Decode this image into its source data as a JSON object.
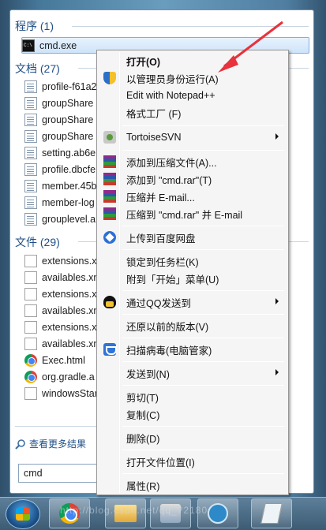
{
  "start_menu": {
    "programs_header": "程序 (1)",
    "programs": [
      {
        "label": "cmd.exe",
        "icon": "cmd-icon"
      }
    ],
    "documents_header": "文档 (27)",
    "documents": [
      {
        "label": "profile-f61a2"
      },
      {
        "label": "groupShare"
      },
      {
        "label": "groupShare"
      },
      {
        "label": "groupShare"
      },
      {
        "label": "setting.ab6e"
      },
      {
        "label": "profile.dbcfe"
      },
      {
        "label": "member.45b"
      },
      {
        "label": "member-log"
      },
      {
        "label": "grouplevel.a"
      }
    ],
    "files_header": "文件 (29)",
    "files": [
      {
        "label": "extensions.x"
      },
      {
        "label": "availables.xn"
      },
      {
        "label": "extensions.x"
      },
      {
        "label": "availables.xn"
      },
      {
        "label": "extensions.x"
      },
      {
        "label": "availables.xn"
      },
      {
        "label": "Exec.html"
      },
      {
        "label": "org.gradle.a"
      },
      {
        "label": "windowsStar"
      }
    ],
    "see_more": "查看更多结果",
    "search_value": "cmd"
  },
  "context_menu": {
    "items": [
      {
        "label": "打开(O)",
        "bold": true
      },
      {
        "label": "以管理员身份运行(A)",
        "icon": "uac-shield-icon"
      },
      {
        "label": "Edit with Notepad++"
      },
      {
        "label": "格式工厂 (F)"
      },
      {
        "label": "TortoiseSVN",
        "icon": "tortoise-svn-icon",
        "submenu": true
      },
      {
        "label": "添加到压缩文件(A)...",
        "icon": "winrar-icon"
      },
      {
        "label": "添加到 \"cmd.rar\"(T)",
        "icon": "winrar-icon"
      },
      {
        "label": "压缩并 E-mail...",
        "icon": "winrar-icon"
      },
      {
        "label": "压缩到 \"cmd.rar\" 并 E-mail",
        "icon": "winrar-icon"
      },
      {
        "label": "上传到百度网盘",
        "icon": "baidu-netdisk-icon"
      },
      {
        "label": "锁定到任务栏(K)"
      },
      {
        "label": "附到「开始」菜单(U)"
      },
      {
        "label": "通过QQ发送到",
        "icon": "qq-icon",
        "submenu": true
      },
      {
        "label": "还原以前的版本(V)"
      },
      {
        "label": "扫描病毒(电脑管家)",
        "icon": "pc-guard-icon"
      },
      {
        "label": "发送到(N)",
        "submenu": true
      },
      {
        "label": "剪切(T)"
      },
      {
        "label": "复制(C)"
      },
      {
        "label": "删除(D)"
      },
      {
        "label": "打开文件位置(I)"
      },
      {
        "label": "属性(R)"
      }
    ]
  },
  "taskbar": {
    "watermark": "http://blog.csdn.net/qq_?2180"
  },
  "colors": {
    "annotation_arrow": "#e8323c",
    "section_header": "#1f4f86"
  }
}
